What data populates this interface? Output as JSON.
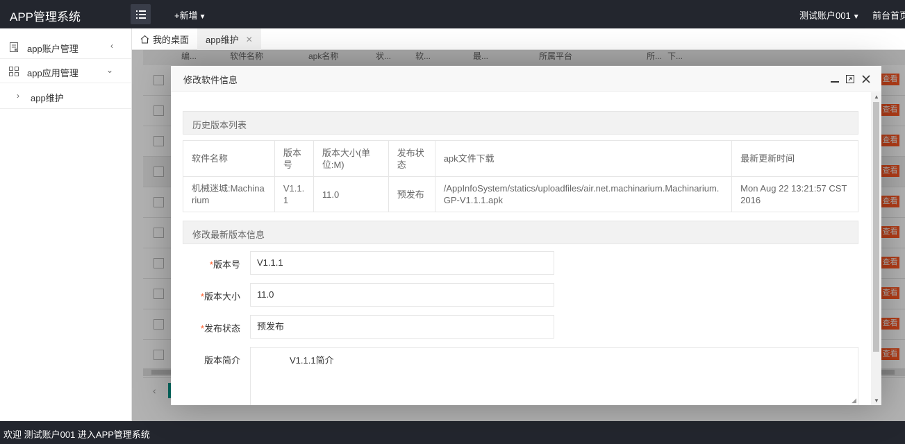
{
  "header": {
    "logo": "APP管理系统",
    "add_label": "+新增",
    "account": "测试账户001",
    "home_link": "前台首页"
  },
  "sidebar": {
    "items": [
      {
        "label": "app账户管理",
        "icon": "document-icon"
      },
      {
        "label": "app应用管理",
        "icon": "grid-icon"
      }
    ],
    "sub_items": [
      {
        "label": "app维护"
      }
    ]
  },
  "tabs": [
    {
      "label": "我的桌面",
      "icon": "home-icon"
    },
    {
      "label": "app维护",
      "close": "✕"
    }
  ],
  "background_table": {
    "view_label": "查看",
    "headers": [
      "编...",
      "软件名称",
      "apk名称",
      "状...",
      "软...",
      "最...",
      "所属平台",
      "所...",
      "下..."
    ]
  },
  "modal": {
    "title": "修改软件信息",
    "history_section": "历史版本列表",
    "history_table": {
      "headers": [
        "软件名称",
        "版本号",
        "版本大小(单位:M)",
        "发布状态",
        "apk文件下载",
        "最新更新时间"
      ],
      "rows": [
        [
          "机械迷城:Machinarium",
          "V1.1.1",
          "11.0",
          "预发布",
          "/AppInfoSystem/statics/uploadfiles/air.net.machinarium.Machinarium.GP-V1.1.1.apk",
          "Mon Aug 22 13:21:57 CST 2016"
        ]
      ]
    },
    "edit_section": "修改最新版本信息",
    "form": {
      "version_no_label": "版本号",
      "version_no_value": "V1.1.1",
      "version_size_label": "版本大小",
      "version_size_value": "11.0",
      "publish_status_label": "发布状态",
      "publish_status_value": "预发布",
      "version_info_label": "版本简介",
      "version_info_value": "V1.1.1简介"
    }
  },
  "footer": {
    "welcome": "欢迎 测试账户001 进入APP管理系统"
  }
}
